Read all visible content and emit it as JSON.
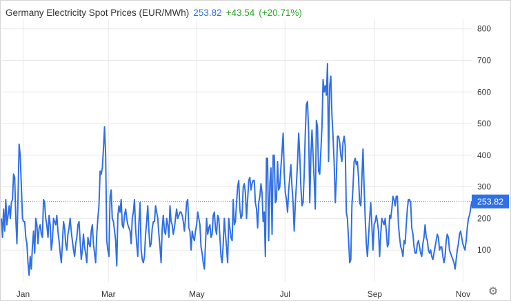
{
  "header": {
    "title": "Germany Electricity Spot Prices (EUR/MWh)",
    "last_value": "253.82",
    "change": "+43.54",
    "change_pct": "(+20.71%)"
  },
  "colors": {
    "line": "#2f6fe8",
    "up": "#2aa52a",
    "grid": "#e8e8e8",
    "last_tag_bg": "#2f6fe8"
  },
  "settings_icon": "gear-icon",
  "chart_data": {
    "type": "line",
    "title": "Germany Electricity Spot Prices (EUR/MWh)",
    "y_ticks": [
      100,
      200,
      300,
      400,
      500,
      600,
      700,
      800
    ],
    "ylim": [
      0,
      830
    ],
    "x_range_days": [
      0,
      325
    ],
    "x_ticks": [
      {
        "label": "Jan",
        "day": 15
      },
      {
        "label": "Mar",
        "day": 74
      },
      {
        "label": "May",
        "day": 135
      },
      {
        "label": "Jul",
        "day": 196
      },
      {
        "label": "Sep",
        "day": 258
      },
      {
        "label": "Nov",
        "day": 319
      }
    ],
    "last_value": 253.82,
    "last_label": "253.82",
    "series": [
      {
        "values": [
          200,
          140,
          230,
          160,
          260,
          180,
          210,
          240,
          200,
          250,
          260,
          340,
          330,
          200,
          120,
          260,
          435,
          400,
          300,
          200,
          190,
          190,
          140,
          120,
          60,
          20,
          80,
          40,
          110,
          160,
          90,
          200,
          180,
          120,
          170,
          180,
          150,
          140,
          260,
          250,
          200,
          180,
          140,
          210,
          180,
          100,
          130,
          200,
          190,
          180,
          210,
          160,
          130,
          90,
          60,
          120,
          190,
          170,
          120,
          100,
          150,
          170,
          200,
          160,
          130,
          100,
          80,
          120,
          140,
          180,
          190,
          130,
          70,
          100,
          150,
          110,
          90,
          60,
          140,
          120,
          110,
          160,
          180,
          120,
          90,
          60,
          150,
          200,
          240,
          350,
          340,
          360,
          420,
          490,
          400,
          130,
          100,
          80,
          270,
          290,
          200,
          190,
          160,
          130,
          50,
          210,
          240,
          220,
          260,
          180,
          170,
          210,
          230,
          200,
          180,
          170,
          160,
          120,
          200,
          220,
          260,
          170,
          120,
          80,
          190,
          250,
          100,
          70,
          60,
          80,
          150,
          190,
          240,
          160,
          110,
          120,
          170,
          190,
          190,
          240,
          220,
          200,
          150,
          110,
          60,
          170,
          210,
          160,
          150,
          200,
          180,
          140,
          240,
          190,
          180,
          150,
          170,
          200,
          230,
          200,
          210,
          220,
          220,
          210,
          190,
          160,
          200,
          250,
          260,
          170,
          160,
          100,
          160,
          140,
          130,
          160,
          180,
          220,
          200,
          180,
          110,
          90,
          60,
          40,
          120,
          200,
          150,
          170,
          180,
          140,
          150,
          210,
          220,
          170,
          150,
          210,
          200,
          140,
          80,
          60,
          120,
          200,
          150,
          110,
          60,
          200,
          170,
          140,
          130,
          260,
          180,
          190,
          250,
          300,
          320,
          230,
          200,
          210,
          300,
          310,
          280,
          200,
          260,
          320,
          330,
          290,
          310,
          320,
          320,
          250,
          230,
          170,
          250,
          270,
          310,
          280,
          190,
          220,
          80,
          390,
          390,
          130,
          310,
          360,
          150,
          400,
          400,
          250,
          260,
          380,
          290,
          300,
          360,
          410,
          470,
          340,
          280,
          260,
          220,
          290,
          330,
          370,
          300,
          250,
          160,
          250,
          310,
          380,
          470,
          400,
          300,
          240,
          250,
          340,
          470,
          560,
          570,
          470,
          250,
          400,
          480,
          400,
          320,
          230,
          510,
          490,
          350,
          340,
          410,
          490,
          640,
          600,
          620,
          590,
          690,
          380,
          620,
          650,
          530,
          460,
          380,
          250,
          330,
          460,
          460,
          440,
          400,
          380,
          440,
          460,
          430,
          220,
          200,
          130,
          60,
          70,
          240,
          300,
          380,
          390,
          370,
          380,
          330,
          250,
          240,
          330,
          420,
          300,
          200,
          120,
          80,
          140,
          200,
          250,
          180,
          100,
          180,
          190,
          210,
          190,
          160,
          80,
          150,
          200,
          190,
          180,
          200,
          160,
          110,
          120,
          210,
          200,
          230,
          270,
          260,
          240,
          270,
          270,
          180,
          140,
          110,
          100,
          80,
          130,
          120,
          180,
          230,
          260,
          260,
          250,
          170,
          150,
          110,
          90,
          90,
          120,
          130,
          110,
          90,
          80,
          120,
          140,
          180,
          140,
          130,
          100,
          90,
          100,
          80,
          70,
          90,
          110,
          130,
          150,
          140,
          100,
          110,
          110,
          80,
          60,
          80,
          130,
          150,
          140,
          100,
          90,
          80,
          70,
          60,
          40,
          70,
          100,
          120,
          150,
          160,
          140,
          120,
          110,
          100,
          130,
          170,
          200,
          210,
          230,
          253.82
        ]
      }
    ],
    "grid": true,
    "legend": "none"
  }
}
